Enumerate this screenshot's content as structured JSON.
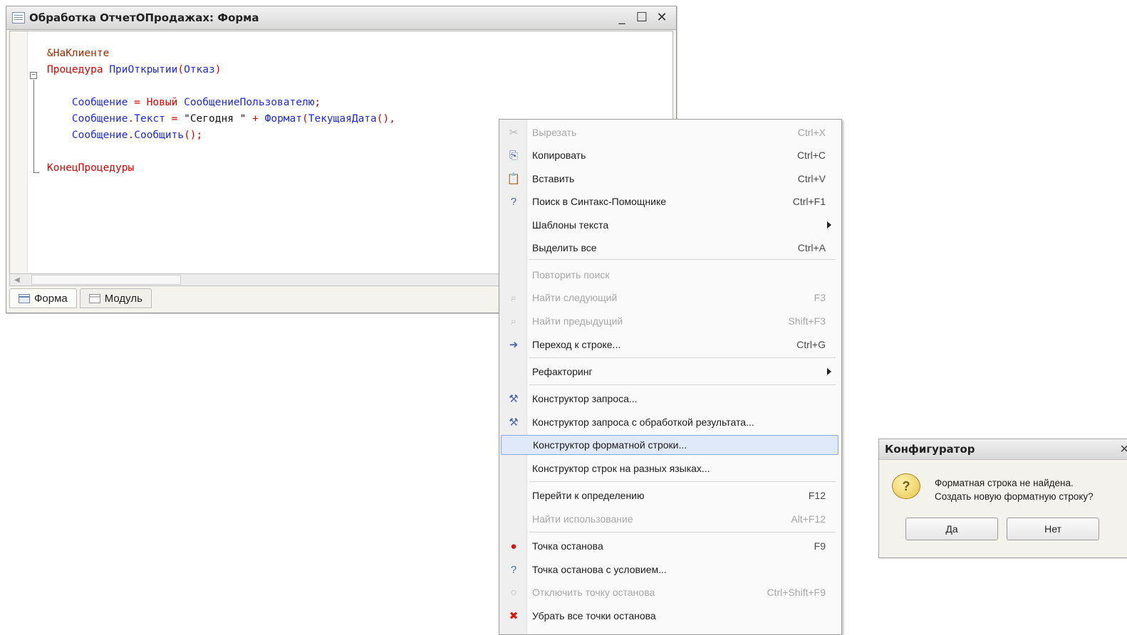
{
  "editor_window": {
    "title": "Обработка ОтчетОПродажах: Форма",
    "controls": {
      "minimize": "_",
      "maximize": "☐",
      "close": "✕"
    },
    "code_lines": [
      [
        {
          "t": "&НаКлиенте",
          "c": "dir"
        }
      ],
      [
        {
          "t": "Процедура",
          "c": "kw"
        },
        {
          "t": " ",
          "c": "str"
        },
        {
          "t": "ПриОткрытии",
          "c": "id"
        },
        {
          "t": "(",
          "c": "op"
        },
        {
          "t": "Отказ",
          "c": "id"
        },
        {
          "t": ")",
          "c": "op"
        }
      ],
      [
        {
          "t": "",
          "c": "str"
        }
      ],
      [
        {
          "t": "    ",
          "c": "str"
        },
        {
          "t": "Сообщение",
          "c": "id"
        },
        {
          "t": " = ",
          "c": "op"
        },
        {
          "t": "Новый",
          "c": "kw"
        },
        {
          "t": " ",
          "c": "str"
        },
        {
          "t": "СообщениеПользователю",
          "c": "id"
        },
        {
          "t": ";",
          "c": "op"
        }
      ],
      [
        {
          "t": "    ",
          "c": "str"
        },
        {
          "t": "Сообщение",
          "c": "id"
        },
        {
          "t": ".",
          "c": "op"
        },
        {
          "t": "Текст",
          "c": "id"
        },
        {
          "t": " = ",
          "c": "op"
        },
        {
          "t": "\"Сегодня \"",
          "c": "str"
        },
        {
          "t": " + ",
          "c": "op"
        },
        {
          "t": "Формат",
          "c": "id"
        },
        {
          "t": "(",
          "c": "op"
        },
        {
          "t": "ТекущаяДата",
          "c": "id"
        },
        {
          "t": "(),",
          "c": "op"
        }
      ],
      [
        {
          "t": "    ",
          "c": "str"
        },
        {
          "t": "Сообщение",
          "c": "id"
        },
        {
          "t": ".",
          "c": "op"
        },
        {
          "t": "Сообщить",
          "c": "id"
        },
        {
          "t": "();",
          "c": "op"
        }
      ],
      [
        {
          "t": "",
          "c": "str"
        }
      ],
      [
        {
          "t": "КонецПроцедуры",
          "c": "kw"
        }
      ]
    ],
    "tabs": [
      {
        "label": "Форма",
        "active": true
      },
      {
        "label": "Модуль",
        "active": false
      }
    ]
  },
  "context_menu": {
    "items": [
      {
        "icon": "scissors-icon",
        "glyph": "✂",
        "label": "Вырезать",
        "shortcut": "Ctrl+X",
        "disabled": true
      },
      {
        "icon": "copy-icon",
        "glyph": "⎘",
        "label": "Копировать",
        "shortcut": "Ctrl+C",
        "disabled": false
      },
      {
        "icon": "paste-icon",
        "glyph": "📋",
        "label": "Вставить",
        "shortcut": "Ctrl+V",
        "disabled": false
      },
      {
        "icon": "syntax-help-search-icon",
        "glyph": "?",
        "label": "Поиск в Синтакс-Помощнике",
        "shortcut": "Ctrl+F1",
        "disabled": false
      },
      {
        "icon": "",
        "glyph": "",
        "label": "Шаблоны текста",
        "shortcut": "",
        "submenu": true,
        "disabled": false
      },
      {
        "icon": "",
        "glyph": "",
        "label": "Выделить все",
        "shortcut": "Ctrl+A",
        "disabled": false
      },
      {
        "separator": true
      },
      {
        "icon": "",
        "glyph": "",
        "label": "Повторить поиск",
        "shortcut": "",
        "disabled": true
      },
      {
        "icon": "find-next-icon",
        "glyph": "⌕",
        "label": "Найти следующий",
        "shortcut": "F3",
        "disabled": true
      },
      {
        "icon": "find-previous-icon",
        "glyph": "⌕",
        "label": "Найти предыдущий",
        "shortcut": "Shift+F3",
        "disabled": true
      },
      {
        "icon": "goto-line-icon",
        "glyph": "➜",
        "label": "Переход к строке...",
        "shortcut": "Ctrl+G",
        "disabled": false
      },
      {
        "separator": true
      },
      {
        "icon": "",
        "glyph": "",
        "label": "Рефакторинг",
        "shortcut": "",
        "submenu": true,
        "disabled": false
      },
      {
        "separator": true
      },
      {
        "icon": "query-builder-icon",
        "glyph": "⚒",
        "label": "Конструктор запроса...",
        "shortcut": "",
        "disabled": false
      },
      {
        "icon": "query-builder-result-icon",
        "glyph": "⚒",
        "label": "Конструктор запроса с обработкой результата...",
        "shortcut": "",
        "disabled": false
      },
      {
        "icon": "",
        "glyph": "",
        "label": "Конструктор форматной строки...",
        "shortcut": "",
        "disabled": false,
        "highlighted": true
      },
      {
        "icon": "",
        "glyph": "",
        "label": "Конструктор строк на разных языках...",
        "shortcut": "",
        "disabled": false
      },
      {
        "separator": true
      },
      {
        "icon": "",
        "glyph": "",
        "label": "Перейти к определению",
        "shortcut": "F12",
        "disabled": false
      },
      {
        "icon": "",
        "glyph": "",
        "label": "Найти использование",
        "shortcut": "Alt+F12",
        "disabled": true
      },
      {
        "separator": true
      },
      {
        "icon": "breakpoint-icon",
        "glyph": "●",
        "label": "Точка останова",
        "shortcut": "F9",
        "disabled": false
      },
      {
        "icon": "conditional-breakpoint-icon",
        "glyph": "?",
        "label": "Точка останова с условием...",
        "shortcut": "",
        "disabled": false
      },
      {
        "icon": "disable-breakpoint-icon",
        "glyph": "○",
        "label": "Отключить точку останова",
        "shortcut": "Ctrl+Shift+F9",
        "disabled": true
      },
      {
        "icon": "remove-breakpoints-icon",
        "glyph": "✖",
        "label": "Убрать все точки останова",
        "shortcut": "",
        "disabled": false
      }
    ]
  },
  "dialog": {
    "title": "Конфигуратор",
    "close": "✕",
    "message_line1": "Форматная строка не найдена.",
    "message_line2": "Создать новую форматную строку?",
    "yes_label": "Да",
    "no_label": "Нет"
  }
}
